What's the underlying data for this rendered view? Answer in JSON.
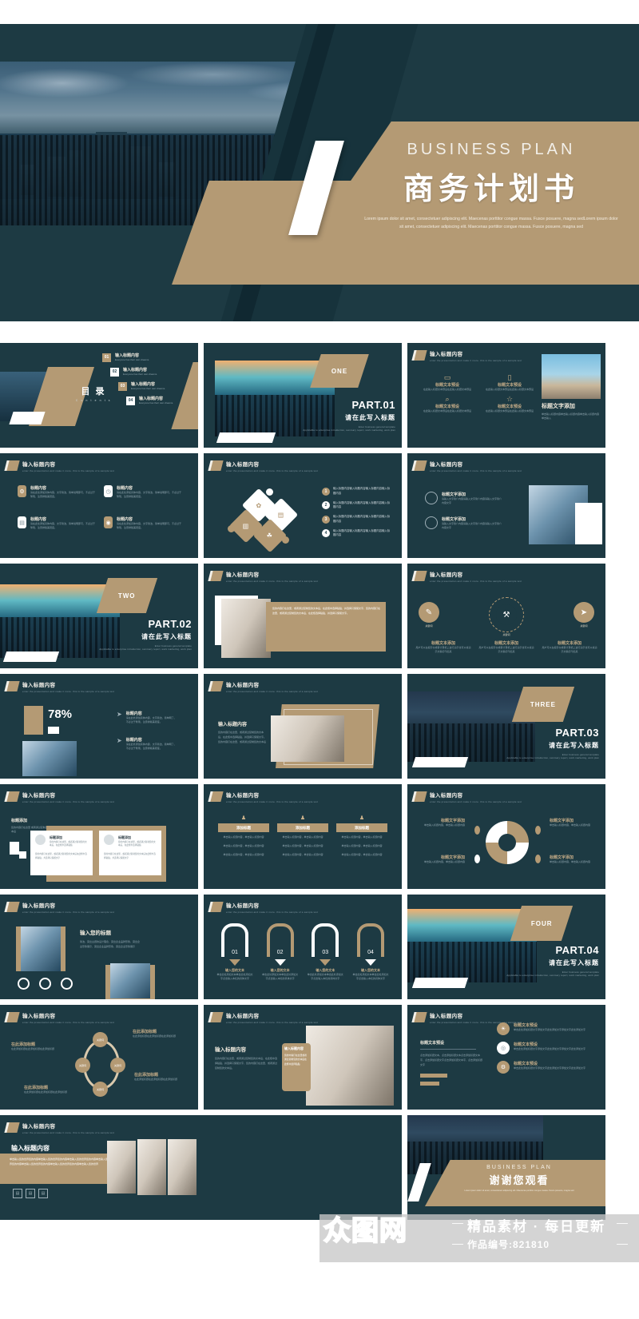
{
  "cover": {
    "title_en": "BUSINESS  PLAN",
    "title_cn": "商务计划书",
    "subtitle": "Lorem ipsum dolor sit amet, consectetuer adipiscing elit. Maecenas porttitor congue massa. Fusce posuere, magna sedLorem ipsum dolor sit amet, consectetuer adipiscing elit. Maecenas porttitor congue massa. Fusce posuere, magna sed"
  },
  "common": {
    "header_title": "输入标题内容",
    "header_sub": "enter the presentation and make it more. this is the sample of a sample text",
    "body_text": "单击输入标题 单击输入标题内容，单击输入标题内容",
    "part_en": "Enter business general template",
    "part_sub": "Applicable to enterprise introduction, summary report, work marketing, work plan"
  },
  "slides": {
    "contents": {
      "title_cn": "目  录",
      "title_en": "C o n t e n t s",
      "items": [
        {
          "num": "01",
          "label": "输入标题内容",
          "sub": "Everyone has their own dreams."
        },
        {
          "num": "02",
          "label": "输入标题内容",
          "sub": "Everyone has their own dreams."
        },
        {
          "num": "03",
          "label": "输入标题内容",
          "sub": "Everyone has their own dreams."
        },
        {
          "num": "04",
          "label": "输入标题内容",
          "sub": "Everyone has their own dreams."
        }
      ]
    },
    "part01": {
      "badge": "ONE",
      "part": "PART.01",
      "title": "请在此写入标题"
    },
    "part02": {
      "badge": "TWO",
      "part": "PART.02",
      "title": "请在此写入标题"
    },
    "part03": {
      "badge": "THREE",
      "part": "PART.03",
      "title": "请在此写入标题"
    },
    "part04": {
      "badge": "FOUR",
      "part": "PART.04",
      "title": "请在此写入标题"
    },
    "icon_grid": {
      "items": [
        {
          "icon": "monitor-icon",
          "label": "标题文本预设",
          "desc": "在此输入标题文本预设在此输入标题文本预设"
        },
        {
          "icon": "phone-icon",
          "label": "标题文本预设",
          "desc": "在此输入标题文本预设在此输入标题文本预设"
        },
        {
          "icon": "search-icon",
          "label": "标题文本预设",
          "desc": "在此输入标题文本预设在此输入标题文本预设"
        },
        {
          "icon": "star-icon",
          "label": "标题文本预设",
          "desc": "在此输入标题文本预设在此输入标题文本预设"
        }
      ],
      "photo_caption": "标题文字添加",
      "photo_desc": "单击输入标题内容单击输入标题内容单击输入标题内容单击输入"
    },
    "four_cards": {
      "items": [
        {
          "label": "标题内容",
          "desc": "请在此处添加具体内容，文字简洁，简单说明即可，不必过于繁琐，注意排版美观度。"
        },
        {
          "label": "标题内容",
          "desc": "请在此处添加具体内容，文字简洁，简单说明即可，不必过于繁琐，注意排版美观度。"
        },
        {
          "label": "标题内容",
          "desc": "请在此处添加具体内容，文字简洁，简单说明即可，不必过于繁琐，注意排版美观度。"
        },
        {
          "label": "标题内容",
          "desc": "请在此处添加具体内容，文字简洁，简单说明即可，不必过于繁琐，注意排版美观度。"
        }
      ]
    },
    "puzzle": {
      "items": [
        {
          "num": "1",
          "text": "输入标题内容输入标题内容输入标题内容输入标题内容"
        },
        {
          "num": "2",
          "text": "输入标题内容输入标题内容输入标题内容输入标题内容"
        },
        {
          "num": "3",
          "text": "输入标题内容输入标题内容输入标题内容输入标题内容"
        },
        {
          "num": "4",
          "text": "输入标题内容输入标题内容输入标题内容输入标题内容"
        }
      ]
    },
    "two_text_photo": {
      "items": [
        {
          "label": "标题文字添加",
          "desc": "请输入文字简介内容请输入文字简介内容请输入文字简介内容文字"
        },
        {
          "label": "标题文字添加",
          "desc": "请输入文字简介内容请输入文字简介内容请输入文字简介内容文字"
        }
      ]
    },
    "handshake": {
      "desc": "您的内容打在这里，或者通过复制您的文本后，在此框中选择粘贴，并选择只保留文字，您的内容打在这里，或者通过复制您的文本后，在此框选择粘贴，并选择只保留文字。"
    },
    "three_icon_circle": {
      "center": "关键词",
      "items": [
        {
          "icon": "pencil-icon",
          "label": "关键词",
          "title": "标题文本添加",
          "desc": "用户可以在投影仪或者计算机上进行演示也可以将演示文稿打印出来"
        },
        {
          "icon": "hammer-icon",
          "label": "关键词",
          "title": "标题文本添加",
          "desc": "用户可以在投影仪或者计算机上进行演示也可以将演示文稿打印出来"
        },
        {
          "icon": "rocket-icon",
          "label": "关键词",
          "title": "标题文本添加",
          "desc": "用户可以在投影仪或者计算机上进行演示也可以将演示文稿打印出来"
        }
      ]
    },
    "percent": {
      "value": "78%",
      "items": [
        {
          "label": "标题内容",
          "desc": "请在此处添加具体内容，文字简洁，简单明了，不必过于繁琐，注意排版美观度。"
        },
        {
          "label": "标题内容",
          "desc": "请在此处添加具体内容，文字简洁，简单明了，不必过于繁琐，注意排版美观度。"
        }
      ]
    },
    "signing": {
      "title": "输入标题内容",
      "desc": "您的内容打在这里，或者通过复制您的文本后，在此框中选择粘贴，并选择只保留文字。您的内容打在这里，或者通过复制您的文本后"
    },
    "profile_cards": {
      "title": "标题添加",
      "desc": "您的内容打在这里 或者通过复制您的文本后",
      "items": [
        {
          "name": "标题添加",
          "line": "您的内容打在这里，或者通过复制您的文本后，在此框中选择粘贴",
          "body": "您的内容打在这里，或者通过复制您的文本后在此框中选择粘贴，并选择只保留文字"
        },
        {
          "name": "标题添加",
          "line": "您的内容打在这里，或者通过复制您的文本后，在此框中选择粘贴",
          "body": "您的内容打在这里，或者通过复制您的文本后在此框中选择粘贴，并选择只保留文字"
        }
      ]
    },
    "three_columns": {
      "items": [
        {
          "label": "添加标题",
          "rows": [
            "单击输入标题内容，单击输入标题内容",
            "单击输入标题内容，单击输入标题内容",
            "单击输入标题内容，单击输入标题内容"
          ]
        },
        {
          "label": "添加标题",
          "rows": [
            "单击输入标题内容，单击输入标题内容",
            "单击输入标题内容，单击输入标题内容",
            "单击输入标题内容，单击输入标题内容"
          ]
        },
        {
          "label": "添加标题",
          "rows": [
            "单击输入标题内容，单击输入标题内容",
            "单击输入标题内容，单击输入标题内容",
            "单击输入标题内容，单击输入标题内容"
          ]
        }
      ]
    },
    "swirl": {
      "items": [
        {
          "label": "标题文字添加",
          "desc": "单击输入标题内容，单击输入标题内容"
        },
        {
          "label": "标题文字添加",
          "desc": "单击输入标题内容，单击输入标题内容"
        },
        {
          "label": "标题文字添加",
          "desc": "单击输入标题内容，单击输入标题内容"
        },
        {
          "label": "标题文字添加",
          "desc": "单击输入标题内容，单击输入标题内容"
        }
      ]
    },
    "your_title": {
      "title": "输入您的标题",
      "desc": "简洁，突出主题的设计理念，突出企业品牌形象，突出企业形象展示，突出企业品牌形象，突出企业形象展示"
    },
    "steps": {
      "items": [
        {
          "num": "01",
          "label": "输入您的文本",
          "desc": "单击此处添加文本单击此处添加文字点击输入本栏的具体文字"
        },
        {
          "num": "02",
          "label": "输入您的文本",
          "desc": "单击此处添加文本单击此处添加文字点击输入本栏的具体文字"
        },
        {
          "num": "03",
          "label": "输入您的文本",
          "desc": "单击此处添加文本单击此处添加文字点击输入本栏的具体文字"
        },
        {
          "num": "04",
          "label": "输入您的文本",
          "desc": "单击此处添加文本单击此处添加文字点击输入本栏的具体文字"
        }
      ]
    },
    "cycle": {
      "node": "关键词",
      "items": [
        {
          "label": "在此添加标题",
          "desc": "在此添加标题在此添加标题在此添加标题"
        },
        {
          "label": "在此添加标题",
          "desc": "在此添加标题在此添加标题在此添加标题"
        },
        {
          "label": "在此添加标题",
          "desc": "在此添加标题在此添加标题在此添加标题"
        },
        {
          "label": "在此添加标题",
          "desc": "在此添加标题在此添加标题在此添加标题"
        }
      ]
    },
    "notebook": {
      "title": "输入标题内容",
      "desc": "您的内容打在这里，或者通过复制您的文本后，在此框中选择粘贴，并选择只保留文字，您的内容打在这里，或者通过复制您的文本后。",
      "card_title": "输入标题内容",
      "card_desc": "您的内容打在这里或者通过复制您的文本后在此框中选择粘贴"
    },
    "text_icons": {
      "left_title": "标题文本预设",
      "left_desc": "点击添加标题文本，点击添加标题文本点击添加标题文本字，点击添加标题文字点击添加标题文本字，点击添加标题文字",
      "items": [
        {
          "icon": "bulb-icon",
          "label": "标题文本预设",
          "desc": "单击此处添加标题文字添加文字此处添加文字添加文字此处添加文字"
        },
        {
          "icon": "target-icon",
          "label": "标题文本预设",
          "desc": "单击此处添加标题文字添加文字此处添加文字添加文字此处添加文字"
        },
        {
          "icon": "gear-icon",
          "label": "标题文本预设",
          "desc": "单击此处添加标题文字添加文字此处添加文字添加文字此处添加文字"
        }
      ]
    },
    "wide_text": {
      "title": "输入标题内容",
      "desc": "单击输入您的世界您的内容单击输入您的世界您的内容单击输入您的世界您的内容单击输入您的世界您的内容单击输入您的世界您的内容单击输入您的世界您的内容单击输入您的世界"
    },
    "thanks": {
      "en": "BUSINESS  PLAN",
      "cn": "谢谢您观看",
      "sub": "Lorem ipsum dolor sit amet, consectetuer adipiscing elit. Maecenas porttitor congue massa. Fusce posuere, magna sed"
    }
  },
  "watermark": {
    "logo": "众图网",
    "line1": "精品素材 · 每日更新",
    "line2": "作品编号:821810"
  },
  "colors": {
    "bg_dark": "#1d3a43",
    "accent_tan": "#b49a74",
    "white": "#ffffff"
  }
}
